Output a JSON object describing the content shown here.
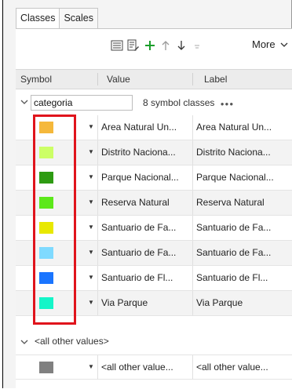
{
  "tabs": [
    "Classes",
    "Scales"
  ],
  "toolbar": {
    "more_label": "More",
    "icons": [
      "list-view-icon",
      "edit-list-icon",
      "add-icon",
      "move-up-icon",
      "move-down-icon",
      "sort-icon",
      "chevron-down-icon"
    ]
  },
  "columns": {
    "symbol": "Symbol",
    "value": "Value",
    "label": "Label"
  },
  "group": {
    "field": "categoria",
    "count_text": "8 symbol classes",
    "more_dots": "●●●"
  },
  "rows": [
    {
      "color": "#F5B83B",
      "value": "Area Natural Un...",
      "label": "Area Natural Un..."
    },
    {
      "color": "#CCFF66",
      "value": "Distrito Naciona...",
      "label": "Distrito Naciona..."
    },
    {
      "color": "#2E9B12",
      "value": "Parque Nacional...",
      "label": "Parque Nacional..."
    },
    {
      "color": "#5CE81A",
      "value": "Reserva Natural",
      "label": "Reserva Natural"
    },
    {
      "color": "#E8E800",
      "value": "Santuario de Fa...",
      "label": "Santuario de Fa..."
    },
    {
      "color": "#7FDAFF",
      "value": "Santuario de Fa...",
      "label": "Santuario de Fa..."
    },
    {
      "color": "#1A75FF",
      "value": "Santuario de Fl...",
      "label": "Santuario de Fl..."
    },
    {
      "color": "#14F5C8",
      "value": "Via Parque",
      "label": "Via Parque"
    }
  ],
  "other_group": {
    "label": "<all other values>",
    "row": {
      "color": "#808080",
      "value": "<all other value...",
      "label": "<all other value..."
    }
  },
  "colors": {
    "highlight": "#E0141C",
    "accent": "#1A9E2A"
  }
}
